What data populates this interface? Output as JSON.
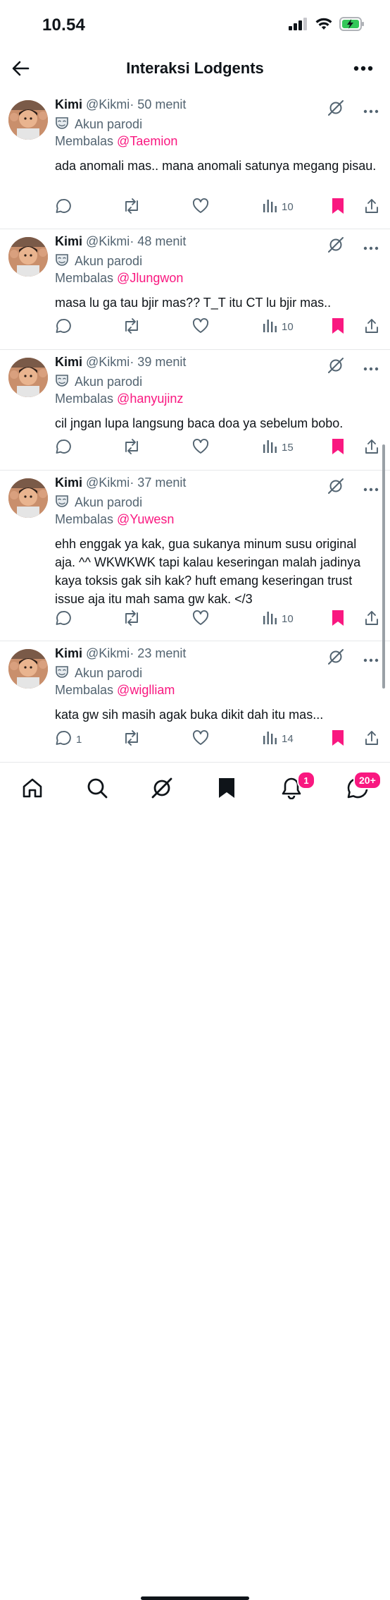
{
  "status_bar": {
    "time": "10.54"
  },
  "header": {
    "title": "Interaksi Lodgents"
  },
  "tweets": [
    {
      "name": "Kimi",
      "handle": "@Kikmi",
      "time": "· 50 menit",
      "badge": "Akun parodi",
      "reply_prefix": "Membalas",
      "reply_to": "@Taemion",
      "text": "ada anomali mas.. mana anomali satunya megang pisau.",
      "replies": "",
      "views": "10",
      "bookmarked": true
    },
    {
      "name": "Kimi",
      "handle": "@Kikmi",
      "time": "· 48 menit",
      "badge": "Akun parodi",
      "reply_prefix": "Membalas",
      "reply_to": "@Jlungwon",
      "text": "masa lu ga tau bjir mas?? T_T itu CT lu bjir mas..",
      "replies": "",
      "views": "10",
      "bookmarked": true
    },
    {
      "name": "Kimi",
      "handle": "@Kikmi",
      "time": "· 39 menit",
      "badge": "Akun parodi",
      "reply_prefix": "Membalas",
      "reply_to": "@hanyujinz",
      "text": "cil jngan lupa langsung baca doa ya sebelum bobo.",
      "replies": "",
      "views": "15",
      "bookmarked": true
    },
    {
      "name": "Kimi",
      "handle": "@Kikmi",
      "time": "· 37 menit",
      "badge": "Akun parodi",
      "reply_prefix": "Membalas",
      "reply_to": "@Yuwesn",
      "text": "ehh enggak ya kak, gua sukanya minum susu original aja. ^^ WKWKWK tapi kalau keseringan malah jadinya kaya toksis gak sih kak? huft emang keseringan trust issue aja itu mah sama gw kak. </3",
      "replies": "",
      "views": "10",
      "bookmarked": true
    },
    {
      "name": "Kimi",
      "handle": "@Kikmi",
      "time": "· 23 menit",
      "badge": "Akun parodi",
      "reply_prefix": "Membalas",
      "reply_to": "@wiglliam",
      "text": "kata gw sih masih agak buka dikit dah itu mas...",
      "replies": "1",
      "views": "14",
      "bookmarked": true
    }
  ],
  "tab_bar": {
    "notifications_badge": "1",
    "messages_badge": "20+"
  },
  "colors": {
    "accent": "#f91880",
    "secondary_text": "#536471",
    "primary_text": "#0f1419"
  }
}
